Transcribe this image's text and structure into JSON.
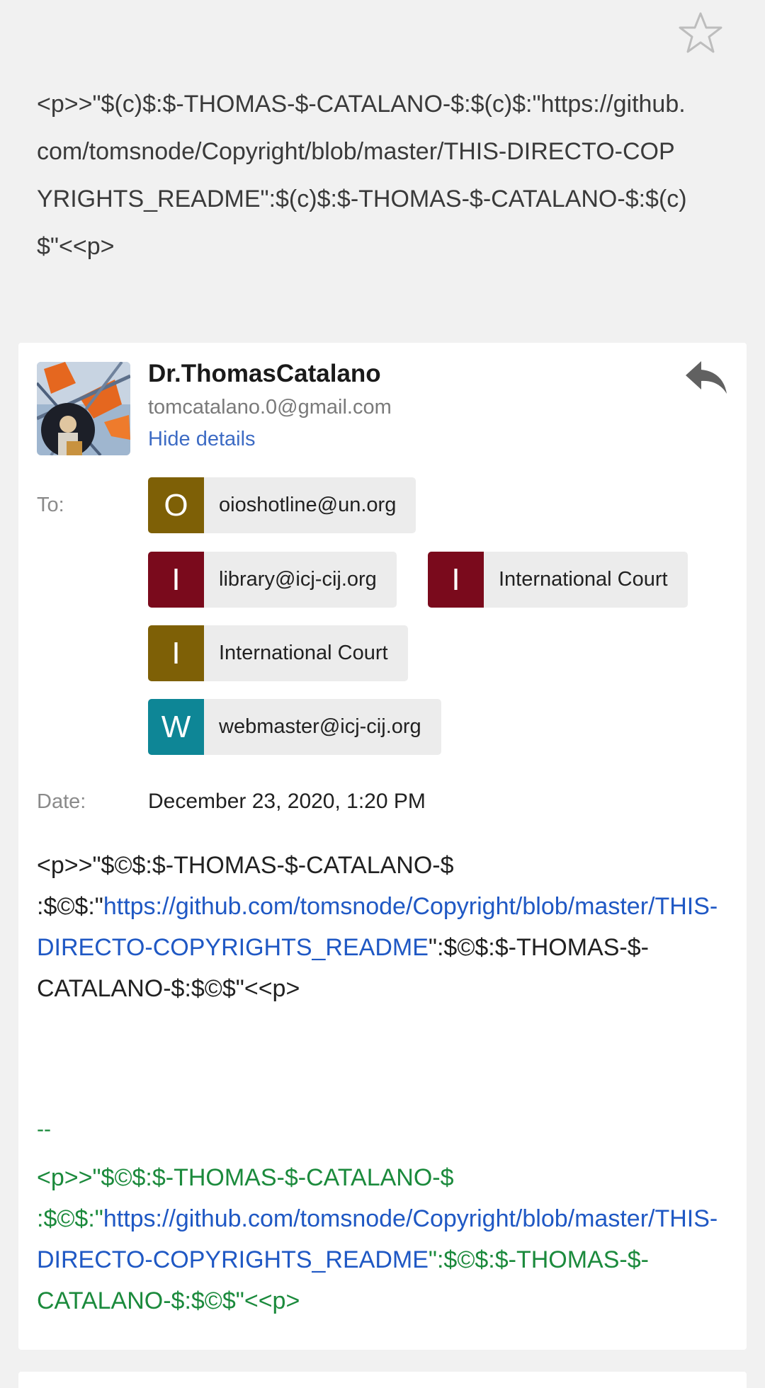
{
  "subject": "<p>>\"$(c)$:$-THOMAS-$-CATALANO-$:$(c)$:\"https://github.com/tomsnode/Copyright/blob/master/THIS-DIRECTO-COPYRIGHTS_README\":$(c)$:$-THOMAS-$-CATALANO-$:$(c)$\"<<p>",
  "icons": {
    "star": "star-outline-icon",
    "reply": "reply-icon"
  },
  "message": {
    "sender_name": "Dr.ThomasCatalano",
    "sender_email": "tomcatalano.0@gmail.com",
    "hide_details": "Hide details",
    "to_label": "To:",
    "recipients": [
      {
        "letter": "O",
        "text": "oioshotline@un.org",
        "color": "#7e6006"
      },
      {
        "letter": "I",
        "text": "library@icj-cij.org",
        "color": "#7a0a1c"
      },
      {
        "letter": "I",
        "text": "International Court",
        "color": "#7a0a1c"
      },
      {
        "letter": "I",
        "text": "International Court",
        "color": "#7e6006"
      },
      {
        "letter": "W",
        "text": "webmaster@icj-cij.org",
        "color": "#0e8696"
      }
    ],
    "date_label": "Date:",
    "date_value": "December 23, 2020, 1:20 PM",
    "body": {
      "prefix": "<p>>\"$©$:$-THOMAS-$-CATALANO-$ :$©$:\"",
      "link": "https://github.com/tomsnode/Copyright/blob/master/THIS-DIRECTO-COPYRIGHTS_README",
      "suffix": "\":$©$:$-THOMAS-$-CATALANO-$:$©$\"<<p>"
    },
    "signature": {
      "separator": "--",
      "prefix": "<p>>\"$©$:$-THOMAS-$-CATALANO-$ :$©$:\"",
      "link": "https://github.com/tomsnode/Copyright/blob/master/THIS-DIRECTO-COPYRIGHTS_README",
      "suffix": "\":$©$:$-THOMAS-$-CATALANO-$:$©$\"<<p>"
    }
  },
  "colors": {
    "link": "#1f58c4",
    "signature": "#1b8a3c",
    "hide_details": "#3d6bc4"
  }
}
